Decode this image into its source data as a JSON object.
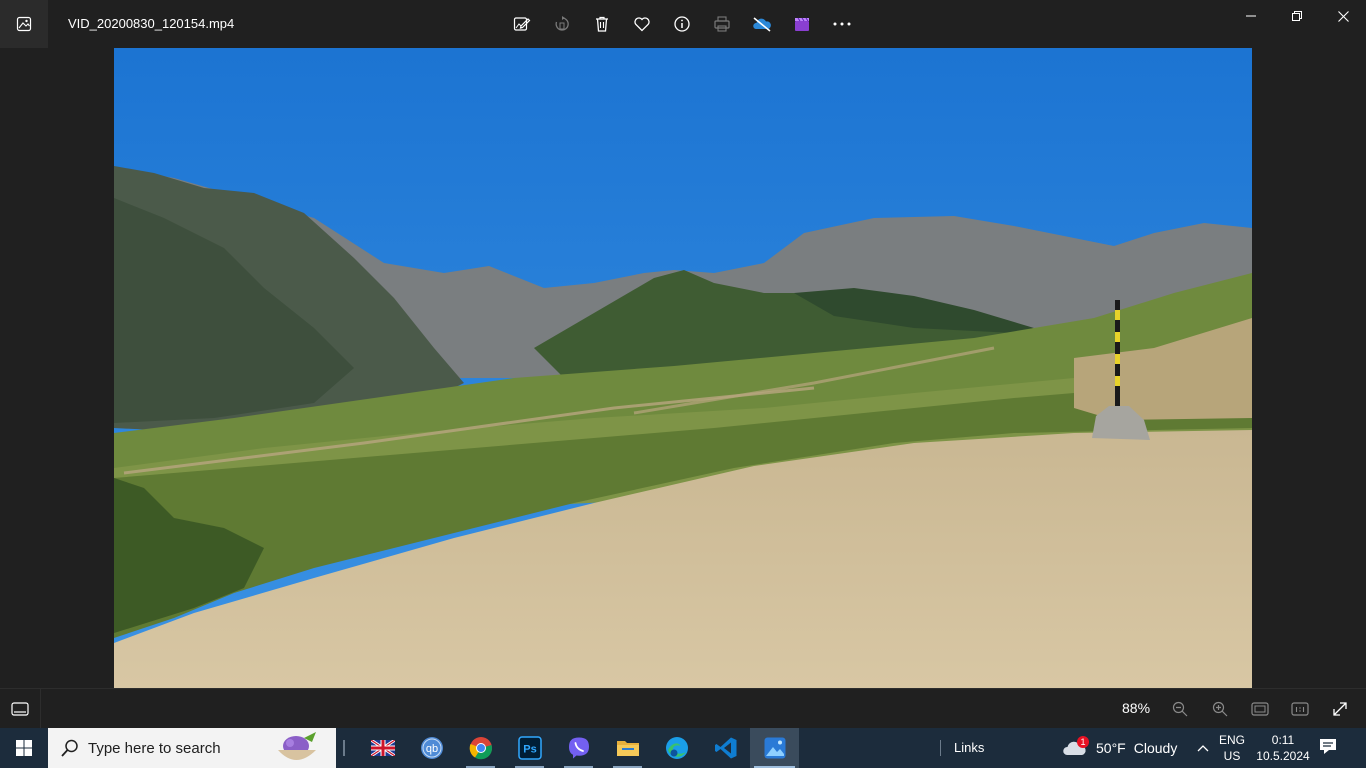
{
  "window": {
    "title": "VID_20200830_120154.mp4"
  },
  "toolbar": {
    "items": [
      "edit-image",
      "rotate",
      "delete",
      "favorite",
      "info",
      "print",
      "onedrive-off",
      "video-editor",
      "more"
    ]
  },
  "viewer": {
    "zoom_label": "88%"
  },
  "taskbar": {
    "search_placeholder": "Type here to search",
    "links_label": "Links",
    "weather": {
      "temp": "50°F",
      "condition": "Cloudy",
      "badge": "1"
    },
    "lang_line1": "ENG",
    "lang_line2": "US",
    "clock_time": "0:11",
    "clock_date": "10.5.2024"
  },
  "colors": {
    "sky": "#1f7fd6",
    "taskbar": "#1c2c3c",
    "titlebar": "#202020"
  }
}
